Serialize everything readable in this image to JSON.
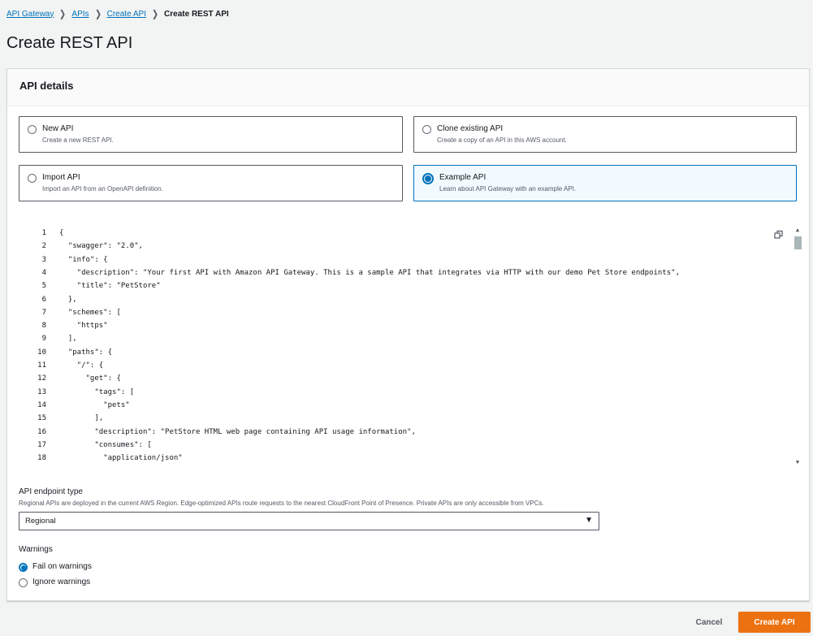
{
  "breadcrumb": {
    "items": [
      "API Gateway",
      "APIs",
      "Create API"
    ],
    "current": "Create REST API"
  },
  "page_title": "Create REST API",
  "api_details": {
    "header": "API details",
    "options": [
      {
        "title": "New API",
        "desc": "Create a new REST API.",
        "selected": false
      },
      {
        "title": "Clone existing API",
        "desc": "Create a copy of an API in this AWS account.",
        "selected": false
      },
      {
        "title": "Import API",
        "desc": "Import an API from an OpenAPI definition.",
        "selected": false
      },
      {
        "title": "Example API",
        "desc": "Learn about API Gateway with an example API.",
        "selected": true
      }
    ]
  },
  "editor": {
    "lines": [
      {
        "n": "1",
        "text": "{"
      },
      {
        "n": "2",
        "text": "  \"swagger\": \"2.0\","
      },
      {
        "n": "3",
        "text": "  \"info\": {"
      },
      {
        "n": "4",
        "text": "    \"description\": \"Your first API with Amazon API Gateway. This is a sample API that integrates via HTTP with our demo Pet Store endpoints\","
      },
      {
        "n": "5",
        "text": "    \"title\": \"PetStore\""
      },
      {
        "n": "6",
        "text": "  },"
      },
      {
        "n": "7",
        "text": "  \"schemes\": ["
      },
      {
        "n": "8",
        "text": "    \"https\""
      },
      {
        "n": "9",
        "text": "  ],"
      },
      {
        "n": "10",
        "text": "  \"paths\": {"
      },
      {
        "n": "11",
        "text": "    \"/\": {"
      },
      {
        "n": "12",
        "text": "      \"get\": {"
      },
      {
        "n": "13",
        "text": "        \"tags\": ["
      },
      {
        "n": "14",
        "text": "          \"pets\""
      },
      {
        "n": "15",
        "text": "        ],"
      },
      {
        "n": "16",
        "text": "        \"description\": \"PetStore HTML web page containing API usage information\","
      },
      {
        "n": "17",
        "text": "        \"consumes\": ["
      },
      {
        "n": "18",
        "text": "          \"application/json\""
      }
    ]
  },
  "endpoint": {
    "label": "API endpoint type",
    "desc": "Regional APIs are deployed in the current AWS Region. Edge-optimized APIs route requests to the nearest CloudFront Point of Presence. Private APIs are only accessible from VPCs.",
    "value": "Regional"
  },
  "warnings": {
    "label": "Warnings",
    "options": [
      {
        "label": "Fail on warnings",
        "selected": true
      },
      {
        "label": "Ignore warnings",
        "selected": false
      }
    ]
  },
  "actions": {
    "cancel": "Cancel",
    "create": "Create API"
  },
  "colors": {
    "link": "#0073bb",
    "selected_border": "#0073bb",
    "primary_button": "#ec7211"
  },
  "icons": {
    "breadcrumb_separator": "chevron-right-icon",
    "copy": "copy-icon",
    "dropdown": "caret-down-icon"
  }
}
